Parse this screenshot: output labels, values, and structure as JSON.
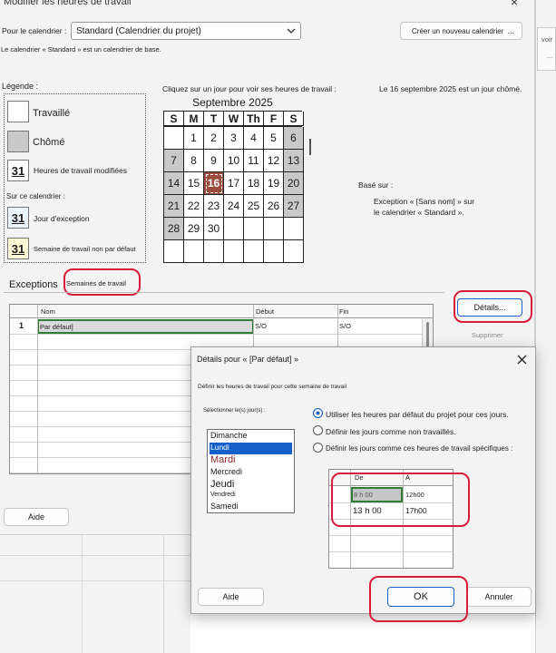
{
  "main": {
    "title": "Modifier les heures de travail",
    "calendar_label": "Pour le calendrier :",
    "calendar_value": "Standard (Calendrier du projet)",
    "new_calendar_button": "Créer un nouveau calendrier",
    "new_calendar_more": "...",
    "base_note": "Le calendrier « Standard » est un calendrier de base.",
    "legend_title": "Légende :",
    "legend": {
      "worked": "Travaillé",
      "nonworked": "Chômé",
      "modified_hours": "Heures de travail modifiées",
      "on_this_calendar": "Sur ce calendrier :",
      "exception_day": "Jour d'exception",
      "nondefault_week": "Semaine de travail non par défaut",
      "icon_number": "31"
    },
    "click_hint": "Cliquez sur un jour pour voir ses heures de travail :",
    "day_status": "Le 16 septembre 2025 est un jour chômé.",
    "based_on_label": "Basé sur :",
    "based_on_line1": "Exception « [Sans nom] » sur",
    "based_on_line2": "le calendrier « Standard ».",
    "side_label_right": "voir",
    "side_dots": "...",
    "calendar": {
      "month": "Septembre 2025",
      "weekdays": [
        "S",
        "M",
        "T",
        "W",
        "Th",
        "F",
        "S"
      ],
      "weeks": [
        [
          "",
          "1",
          "2",
          "3",
          "4",
          "5",
          "6"
        ],
        [
          "7",
          "8",
          "9",
          "10",
          "11",
          "12",
          "13"
        ],
        [
          "14",
          "15",
          "16",
          "17",
          "18",
          "19",
          "20"
        ],
        [
          "21",
          "22",
          "23",
          "24",
          "25",
          "26",
          "27"
        ],
        [
          "28",
          "29",
          "30",
          "",
          "",
          "",
          ""
        ],
        [
          "",
          "",
          "",
          "",
          "",
          "",
          ""
        ]
      ],
      "selected_day": "16"
    },
    "tabs": {
      "exceptions": "Exceptions",
      "work_weeks": "Semaines de travail"
    },
    "table": {
      "headers": [
        "Nom",
        "Début",
        "Fin"
      ],
      "rows": [
        {
          "num": "1",
          "name": "Par défaut]",
          "start": "S/O",
          "end": "S/O"
        }
      ]
    },
    "details_button": "Détails...",
    "delete_button": "Supprimer",
    "help_button": "Aide"
  },
  "details": {
    "title": "Détails pour « [Par défaut] »",
    "define_label": "Définir les heures de travail pour cette semaine de travail",
    "select_days_label": "Sélectionner le(s) jour(s) :",
    "days": [
      "Dimanche",
      "Lundi",
      "Mardi",
      "Mercredi",
      "Jeudi",
      "Vendredi",
      "Samedi"
    ],
    "selected_day": "Lundi",
    "option_default": "Utiliser les heures par défaut du projet pour ces jours.",
    "option_nonworking": "Définir les jours comme non travaillés.",
    "option_specific": "Définir les jours comme ces heures de travail spécifiques :",
    "hours_headers": [
      "De",
      "À"
    ],
    "hours": [
      {
        "from": "8 h 00",
        "to": "12h00"
      },
      {
        "from": "13 h 00",
        "to": "17h00"
      }
    ],
    "help_button": "Aide",
    "ok_button": "OK",
    "cancel_button": "Annuler"
  },
  "colors": {
    "accent": "#1460c8",
    "annotation": "#d81d3a",
    "selected_day": "#9b4b3c",
    "nonworking_gray": "#c9c9c9",
    "selection_green": "#2e7d32"
  }
}
